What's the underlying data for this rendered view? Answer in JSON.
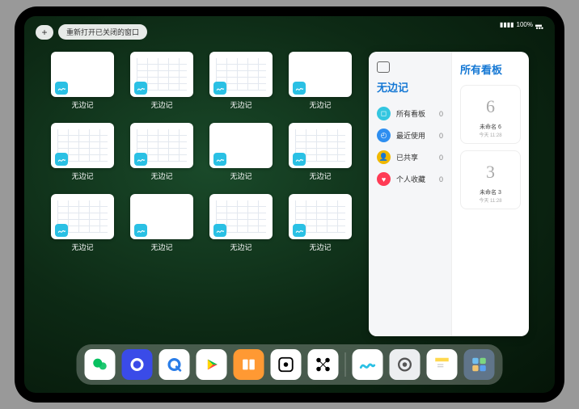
{
  "status": {
    "signal": "▮▮▮▮",
    "wifi": "◈",
    "battery": "100%"
  },
  "top": {
    "plus": "+",
    "reopen_label": "重新打开已关闭的窗口",
    "more": "•••"
  },
  "thumbs": {
    "label": "无边记",
    "items": [
      {
        "style": "blank"
      },
      {
        "style": "grid-doc"
      },
      {
        "style": "grid-doc"
      },
      {
        "style": "blank"
      },
      {
        "style": "grid-doc"
      },
      {
        "style": "grid-doc"
      },
      {
        "style": "blank"
      },
      {
        "style": "grid-doc"
      },
      {
        "style": "grid-doc"
      },
      {
        "style": "blank"
      },
      {
        "style": "grid-doc"
      },
      {
        "style": "grid-doc"
      }
    ]
  },
  "panel": {
    "left_title": "无边记",
    "rows": [
      {
        "icon_bg": "#34c6e0",
        "glyph": "◻",
        "label": "所有看板",
        "count": "0"
      },
      {
        "icon_bg": "#2e8ef0",
        "glyph": "◴",
        "label": "最近使用",
        "count": "0"
      },
      {
        "icon_bg": "#f0b800",
        "glyph": "👤",
        "label": "已共享",
        "count": "0"
      },
      {
        "icon_bg": "#ff3b55",
        "glyph": "♥",
        "label": "个人收藏",
        "count": "0"
      }
    ],
    "right_title": "所有看板",
    "boards": [
      {
        "glyph": "6",
        "label": "未命名 6",
        "time": "今天 11:28"
      },
      {
        "glyph": "3",
        "label": "未命名 3",
        "time": "今天 11:28"
      }
    ]
  },
  "dock": [
    {
      "name": "wechat",
      "bg": "#ffffff",
      "fg": "#07c160",
      "glyph": "wechat"
    },
    {
      "name": "quark",
      "bg": "#3a4be8",
      "fg": "#ffffff",
      "glyph": "circle"
    },
    {
      "name": "browser",
      "bg": "#ffffff",
      "fg": "#2a7de8",
      "glyph": "q"
    },
    {
      "name": "play",
      "bg": "#ffffff",
      "fg": "#00c853",
      "glyph": "play"
    },
    {
      "name": "books",
      "bg": "#ff9933",
      "fg": "#ffffff",
      "glyph": "book"
    },
    {
      "name": "dice",
      "bg": "#ffffff",
      "fg": "#000000",
      "glyph": "dot"
    },
    {
      "name": "connect",
      "bg": "#ffffff",
      "fg": "#000000",
      "glyph": "nodes"
    },
    {
      "name": "sep"
    },
    {
      "name": "freeform",
      "bg": "#ffffff",
      "fg": "#2ac0e4",
      "glyph": "freeform"
    },
    {
      "name": "settings",
      "bg": "#eceef0",
      "fg": "#555555",
      "glyph": "gear"
    },
    {
      "name": "notes",
      "bg": "#ffffff",
      "fg": "#ffd84d",
      "glyph": "notes"
    },
    {
      "name": "app-library",
      "bg": "#60758a",
      "fg": "#ffffff",
      "glyph": "grid4"
    }
  ]
}
